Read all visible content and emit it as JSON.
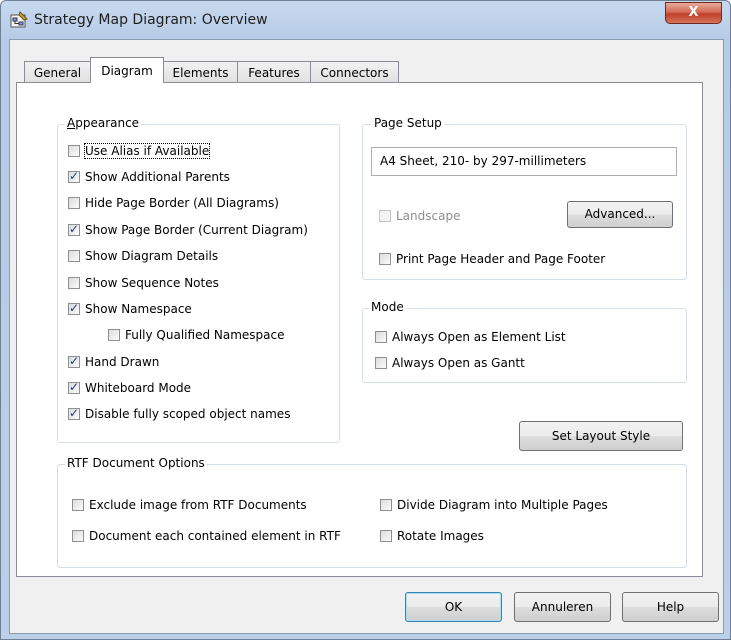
{
  "window": {
    "title": "Strategy Map Diagram: Overview",
    "close_label": "X"
  },
  "tabs": [
    {
      "label": "General",
      "active": false
    },
    {
      "label": "Diagram",
      "active": true
    },
    {
      "label": "Elements",
      "active": false
    },
    {
      "label": "Features",
      "active": false
    },
    {
      "label": "Connectors",
      "active": false
    }
  ],
  "appearance": {
    "title": "Appearance",
    "options": [
      {
        "label": "Use Alias if Available",
        "checked": false
      },
      {
        "label": "Show Additional Parents",
        "checked": true
      },
      {
        "label": "Hide Page Border (All Diagrams)",
        "checked": false
      },
      {
        "label": "Show Page Border (Current Diagram)",
        "checked": true
      },
      {
        "label": "Show Diagram Details",
        "checked": false
      },
      {
        "label": "Show Sequence Notes",
        "checked": false
      },
      {
        "label": "Show Namespace",
        "checked": true
      },
      {
        "label": "Fully Qualified Namespace",
        "checked": false
      },
      {
        "label": "Hand Drawn",
        "checked": true
      },
      {
        "label": "Whiteboard Mode",
        "checked": true
      },
      {
        "label": "Disable fully scoped object names",
        "checked": true
      }
    ]
  },
  "page_setup": {
    "title": "Page Setup",
    "paper": "A4 Sheet, 210- by 297-millimeters",
    "landscape": {
      "label": "Landscape",
      "checked": false,
      "enabled": false
    },
    "advanced_label": "Advanced...",
    "header_footer": {
      "label": "Print Page Header and Page Footer",
      "checked": false
    }
  },
  "mode": {
    "title": "Mode",
    "options": [
      {
        "label": "Always Open as Element List",
        "checked": false
      },
      {
        "label": "Always Open as Gantt",
        "checked": false
      }
    ]
  },
  "set_layout_style_label": "Set Layout Style",
  "rtf": {
    "title": "RTF Document Options",
    "options": [
      {
        "label": "Exclude image from RTF Documents",
        "checked": false
      },
      {
        "label": "Divide Diagram into Multiple Pages",
        "checked": false
      },
      {
        "label": "Document each contained element in RTF",
        "checked": false
      },
      {
        "label": "Rotate Images",
        "checked": false
      }
    ]
  },
  "footer": {
    "ok_label": "OK",
    "cancel_label": "Annuleren",
    "help_label": "Help"
  },
  "accent": "#1b3c8a"
}
